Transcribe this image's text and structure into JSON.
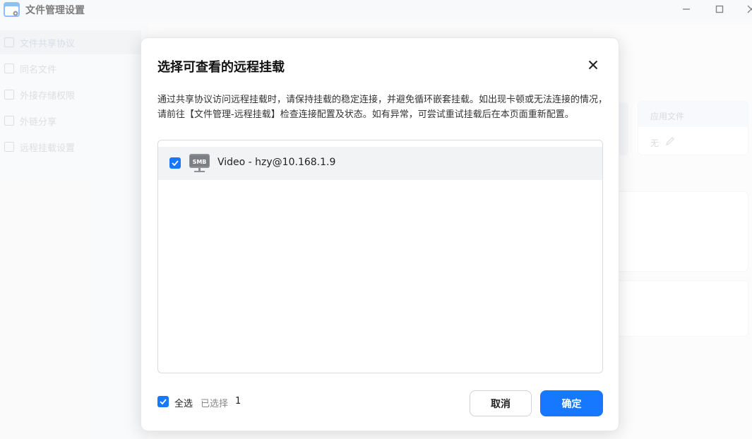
{
  "window": {
    "title": "文件管理设置"
  },
  "sidebar": {
    "items": [
      {
        "label": "文件共享协议"
      },
      {
        "label": "同名文件"
      },
      {
        "label": "外接存储权限"
      },
      {
        "label": "外链分享"
      },
      {
        "label": "远程挂载设置"
      }
    ]
  },
  "background": {
    "column_header": "应用文件",
    "cell_value": "无"
  },
  "dialog": {
    "title": "选择可查看的远程挂载",
    "description": "通过共享协议访问远程挂载时，请保持挂载的稳定连接，并避免循环嵌套挂载。如出现卡顿或无法连接的情况，请前往【文件管理-远程挂载】检查连接配置及状态。如有异常，可尝试重试挂载后在本页面重新配置。",
    "items": [
      {
        "label": "Video - hzy@10.168.1.9",
        "icon": "smb-icon",
        "icon_text": "SMB",
        "checked": true
      }
    ],
    "select_all_label": "全选",
    "selected_label": "已选择",
    "selected_count": "1",
    "cancel_label": "取消",
    "confirm_label": "确定"
  },
  "colors": {
    "accent": "#1677ff"
  }
}
